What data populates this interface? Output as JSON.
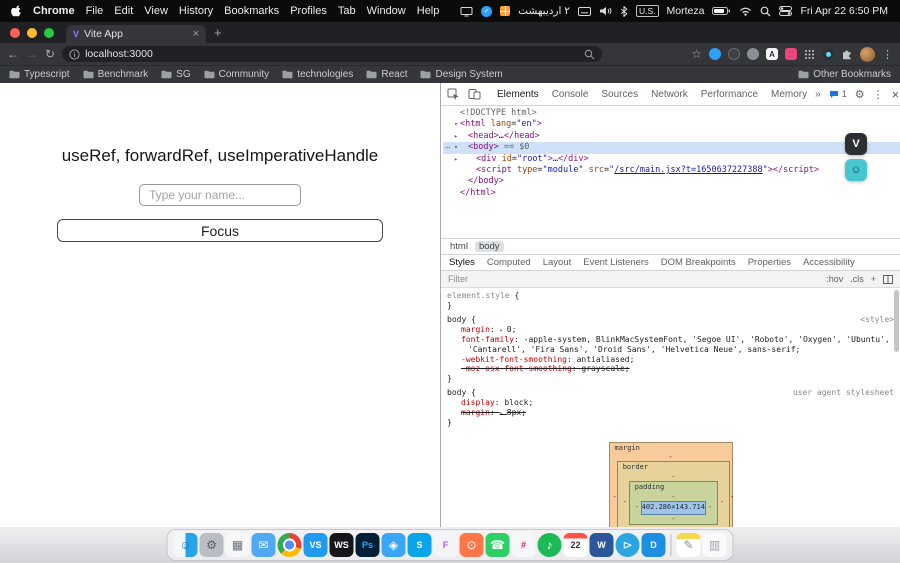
{
  "menubar": {
    "app": "Chrome",
    "items": [
      "File",
      "Edit",
      "View",
      "History",
      "Bookmarks",
      "Profiles",
      "Tab",
      "Window",
      "Help"
    ],
    "persian_date": "۲ اردیبهشت",
    "input_source": "U.S.",
    "username": "Morteza",
    "clock": "Fri Apr 22 6:50 PM"
  },
  "icons": {
    "back": "←",
    "forward": "→",
    "reload": "↻",
    "new_tab": "+",
    "close": "×",
    "star": "☆",
    "kebab": "⋮",
    "more": "»",
    "gear": "⚙",
    "plus": "+",
    "ext_a": "A"
  },
  "browser": {
    "tab_title": "Vite App",
    "url": "localhost:3000",
    "bookmarks": [
      "Typescript",
      "Benchmark",
      "SG",
      "Community",
      "technologies",
      "React",
      "Design System"
    ],
    "other_bookmarks": "Other Bookmarks"
  },
  "page": {
    "heading": "useRef, forwardRef, useImperativeHandle",
    "input_placeholder": "Type your name...",
    "button_label": "Focus"
  },
  "devtools": {
    "tabs": [
      "Elements",
      "Console",
      "Sources",
      "Network",
      "Performance",
      "Memory"
    ],
    "active_tab": "Elements",
    "issues_count": "1",
    "tree": [
      {
        "indent": 0,
        "tokens": [
          [
            "<!DOCTYPE html>",
            "doctype"
          ]
        ]
      },
      {
        "indent": 0,
        "arrow": "▾",
        "tokens": [
          [
            "<html",
            "tag"
          ],
          [
            " lang",
            "attr"
          ],
          [
            "=",
            "plain"
          ],
          [
            "\"en\"",
            "val"
          ],
          [
            ">",
            "tag"
          ]
        ]
      },
      {
        "indent": 1,
        "arrow": "▸",
        "tokens": [
          [
            "<head>",
            "tag"
          ],
          [
            "…",
            "plain"
          ],
          [
            "</head>",
            "tag"
          ]
        ]
      },
      {
        "indent": 1,
        "arrow": "▾",
        "selected": true,
        "tokens": [
          [
            "<body>",
            "tag"
          ],
          [
            " == $0",
            "dollar"
          ]
        ]
      },
      {
        "indent": 2,
        "arrow": "▸",
        "tokens": [
          [
            "<div",
            "tag"
          ],
          [
            " id",
            "attr"
          ],
          [
            "=",
            "plain"
          ],
          [
            "\"root\"",
            "val"
          ],
          [
            ">",
            "tag"
          ],
          [
            "…",
            "plain"
          ],
          [
            "</div>",
            "tag"
          ]
        ]
      },
      {
        "indent": 2,
        "tokens": [
          [
            "<script",
            "tag"
          ],
          [
            " type",
            "attr"
          ],
          [
            "=",
            "plain"
          ],
          [
            "\"module\"",
            "val"
          ],
          [
            " src",
            "attr"
          ],
          [
            "=",
            "plain"
          ],
          [
            "\"",
            "val"
          ],
          [
            "/src/main.jsx?t=1650637227388",
            "link"
          ],
          [
            "\"",
            "val"
          ],
          [
            ">",
            "tag"
          ],
          [
            "</script>",
            "tag"
          ]
        ]
      },
      {
        "indent": 1,
        "tokens": [
          [
            "</body>",
            "tag"
          ]
        ]
      },
      {
        "indent": 0,
        "tokens": [
          [
            "</html>",
            "tag"
          ]
        ]
      }
    ],
    "breadcrumbs": [
      {
        "label": "html",
        "selected": false
      },
      {
        "label": "body",
        "selected": true
      }
    ],
    "sidebar_tabs": [
      "Styles",
      "Computed",
      "Layout",
      "Event Listeners",
      "DOM Breakpoints",
      "Properties",
      "Accessibility"
    ],
    "active_sidebar_tab": "Styles",
    "filter_placeholder": "Filter",
    "pseudo_toggle": ":hov",
    "class_toggle": ".cls",
    "rules": [
      {
        "selector": "element.style",
        "gray": true,
        "origin": "",
        "props": []
      },
      {
        "selector": "body",
        "origin": "<style>",
        "props": [
          {
            "name": "margin",
            "value": "0",
            "shorthand": true
          },
          {
            "name": "font-family",
            "value": "-apple-system, BlinkMacSystemFont, 'Segoe UI', 'Roboto', 'Oxygen', 'Ubuntu', 'Cantarell', 'Fira Sans', 'Droid Sans', 'Helvetica Neue', sans-serif"
          },
          {
            "name": "-webkit-font-smoothing",
            "value": "antialiased"
          },
          {
            "name": "-moz-osx-font-smoothing",
            "value": "grayscale",
            "struck": true
          }
        ]
      },
      {
        "selector": "body",
        "origin": "user agent stylesheet",
        "props": [
          {
            "name": "display",
            "value": "block"
          },
          {
            "name": "margin",
            "value": "8px",
            "shorthand": true,
            "struck": true
          }
        ]
      }
    ],
    "box_model": {
      "margin": "margin",
      "border": "border",
      "padding": "padding",
      "content": "402.286×143.714",
      "dash": "-"
    }
  },
  "overlays": [
    {
      "glyph": "V"
    },
    {
      "glyph": "☺"
    }
  ],
  "dock": [
    {
      "name": "finder",
      "bg": "linear-gradient(90deg,#f5f8fb 0 50%,#27a3e8 50%)",
      "fg": "#1673b4",
      "glyph": "☺"
    },
    {
      "name": "system-preferences",
      "bg": "#b9bec5",
      "fg": "#555b63",
      "glyph": "⚙"
    },
    {
      "name": "launchpad",
      "bg": "rgba(250,250,252,.75)",
      "fg": "#6b7077",
      "glyph": "▦"
    },
    {
      "name": "mail",
      "bg": "#51a9f3",
      "fg": "#ffffff",
      "glyph": "✉"
    },
    {
      "name": "chrome",
      "glyph": ""
    },
    {
      "name": "vscode",
      "bg": "#1f9cf0",
      "fg": "#ffffff",
      "glyph": "VS",
      "small": true
    },
    {
      "name": "webstorm",
      "bg": "#15161a",
      "fg": "#ffffff",
      "glyph": "WS",
      "small": true
    },
    {
      "name": "photoshop",
      "bg": "#001e36",
      "fg": "#31a8ff",
      "glyph": "Ps",
      "small": true
    },
    {
      "name": "safari",
      "bg": "#3aa6f6",
      "fg": "#ffffff",
      "glyph": "◈"
    },
    {
      "name": "skype",
      "bg": "#0aa4e8",
      "fg": "#ffffff",
      "glyph": "S",
      "small": true
    },
    {
      "name": "figma",
      "bg": "#f4f4f6",
      "fg": "#a259ff",
      "glyph": "F",
      "small": true
    },
    {
      "name": "postman",
      "bg": "#ff7648",
      "fg": "#ffffff",
      "glyph": "⊙"
    },
    {
      "name": "whatsapp",
      "bg": "#2ed066",
      "fg": "#ffffff",
      "glyph": "☎"
    },
    {
      "name": "slack",
      "bg": "#f7f7f9",
      "fg": "#e01e5a",
      "glyph": "#",
      "small": true
    },
    {
      "name": "spotify",
      "bg": "#1db954",
      "fg": "#ffffff",
      "glyph": "♪",
      "round": true
    },
    {
      "name": "calendar",
      "bg": "linear-gradient(180deg,#ff5347 0 22%,#ffffff 22%)",
      "fg": "#33363c",
      "glyph": "22",
      "small": true
    },
    {
      "name": "word",
      "bg": "#2b579a",
      "fg": "#ffffff",
      "glyph": "W",
      "small": true
    },
    {
      "name": "telegram",
      "bg": "#2ca5e0",
      "fg": "#ffffff",
      "glyph": "⊳",
      "round": true
    },
    {
      "name": "docker",
      "bg": "#1d8fe1",
      "fg": "#ffffff",
      "glyph": "D",
      "small": true
    },
    {
      "name": "dock-separator",
      "sep": true
    },
    {
      "name": "notes",
      "bg": "linear-gradient(180deg,#f7d94c 0 24%,#ffffff 24%)",
      "fg": "#8d9299",
      "glyph": "✎"
    },
    {
      "name": "trash",
      "bg": "rgba(252,252,254,.85)",
      "fg": "#9aa0a8",
      "glyph": "▥"
    }
  ]
}
